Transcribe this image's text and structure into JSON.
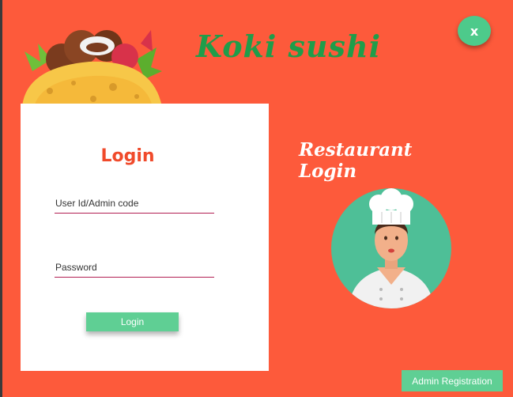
{
  "app": {
    "title": "Koki sushi"
  },
  "window": {
    "close_label": "x"
  },
  "login_card": {
    "heading": "Login",
    "user_field_placeholder": "User Id/Admin code",
    "password_field_placeholder": "Password",
    "login_button_label": "Login"
  },
  "side": {
    "heading": "Restaurant Login"
  },
  "footer": {
    "admin_registration_label": "Admin Registration"
  },
  "icons": {
    "logo": "taco-icon",
    "avatar": "chef-icon"
  },
  "colors": {
    "background": "#fd5a3b",
    "accent_green": "#5fcf94",
    "title_green": "#1f9d4a",
    "heading_red": "#f04a2b",
    "field_underline": "#b21e52"
  }
}
